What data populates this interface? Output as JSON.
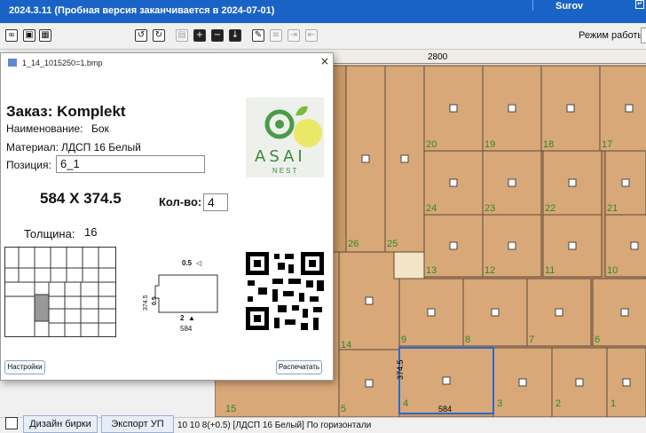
{
  "titlebar": {
    "title": "2024.3.11  (Пробная версия заканчивается в 2024-07-01)",
    "user": "Surov",
    "bg": "#1a63c6"
  },
  "toolbar": {
    "mode_label": "Режим работы :"
  },
  "canvas": {
    "width_label": "2800",
    "panel_fill": "#d9a878",
    "panel_stroke": "#5b4a3a",
    "numbers": [
      "20",
      "19",
      "18",
      "17",
      "24",
      "23",
      "22",
      "21",
      "26",
      "25",
      "13",
      "12",
      "11",
      "10",
      "9",
      "8",
      "7",
      "6",
      "15",
      "14",
      "5",
      "4",
      "3",
      "2",
      "1"
    ],
    "dim_vertical": "374.5",
    "dim_horizontal": "584"
  },
  "dialog": {
    "filename": "1_14_1015250=1.bmp",
    "close_glyph": "×",
    "order_label": "Заказ: Komplekt",
    "name_label": "Наименование:",
    "name_value": "Бок",
    "material_label": "Материал:",
    "material_value": "ЛДСП 16 Белый",
    "position_label": "Позиция:",
    "position_value": "6_1",
    "size": "584 X 374.5",
    "qty_label": "Кол-во:",
    "qty_value": "4",
    "thickness_label": "Толщина:",
    "thickness_value": "16",
    "logo_text": "ASAI",
    "logo_sub": "NEST",
    "edge_top": "0.5",
    "edge_left": "0.5",
    "edge_side": "374.5",
    "edge_bottom": "2",
    "edge_width": "584",
    "settings_button": "Настройки",
    "print_button": "Распечатать"
  },
  "bottom": {
    "design_button": "Дизайн бирки",
    "export_button": "Экспорт УП",
    "status_text": "10 10  8(+0.5)  [ЛДСП 16 Белый]  По горизонтали"
  }
}
